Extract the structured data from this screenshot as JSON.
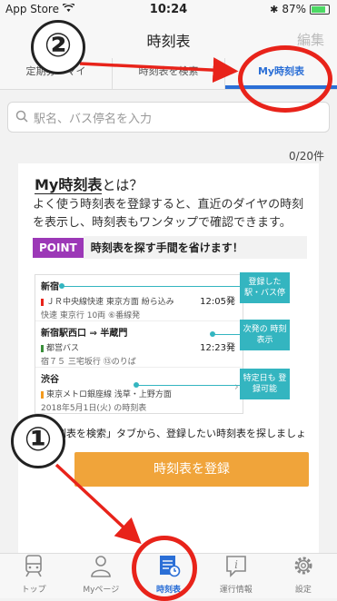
{
  "status_bar": {
    "carrier": "App Store",
    "time": "10:24",
    "battery": "87%"
  },
  "nav": {
    "title": "時刻表",
    "edit": "編集"
  },
  "tabs": [
    {
      "label": "定期券・マイ"
    },
    {
      "label": "時刻表を検索"
    },
    {
      "label": "My時刻表"
    }
  ],
  "search": {
    "placeholder": "駅名、バス停名を入力"
  },
  "count": "0/20件",
  "intro": {
    "title_bold": "My時刻表",
    "title_rest": "とは？",
    "text": "よく使う時刻表を登録すると、直近のダイヤの時刻を表示し、時刻表もワンタップで確認できます。",
    "point_badge": "POINT",
    "point_text": "時刻表を探す手間を省けます！"
  },
  "examples": [
    {
      "station": "新宿",
      "line": "ＪＲ中央線快速 東京方面 紛ら込み",
      "sub": "快速 東京行 10両 ⑥番線発",
      "dep": "12:05発",
      "line_color": "#e8231a"
    },
    {
      "station": "新宿駅西口 ⇒ 半蔵門",
      "line": "都営バス",
      "sub": "宿７５ 三宅坂行 ⑬のりば",
      "dep": "12:23発",
      "line_color": "#3a8f3a"
    },
    {
      "station": "渋谷",
      "line": "東京メトロ銀座線 浅草・上野方面",
      "sub": "2018年5月1日(火) の時刻表",
      "dep": "",
      "line_color": "#f39a1e"
    }
  ],
  "callouts": [
    "登録した 駅・バス停",
    "次発の 時刻表示",
    "特定日も 登録可能"
  ],
  "hint": "「時刻表を検索」タブから、登録したい時刻表を探しましょう",
  "register_button": "時刻表を登録",
  "tabbar": [
    {
      "label": "トップ",
      "icon": "train-icon"
    },
    {
      "label": "Myページ",
      "icon": "person-icon"
    },
    {
      "label": "時刻表",
      "icon": "timetable-icon"
    },
    {
      "label": "運行情報",
      "icon": "info-icon"
    },
    {
      "label": "設定",
      "icon": "gear-icon"
    }
  ],
  "annotations": {
    "step1": "①",
    "step2": "②"
  },
  "colors": {
    "accent": "#2b6fd6",
    "orange": "#f0a43a",
    "teal": "#34b5c0",
    "purple": "#9c38b7",
    "annotation_red": "#e8231a"
  }
}
